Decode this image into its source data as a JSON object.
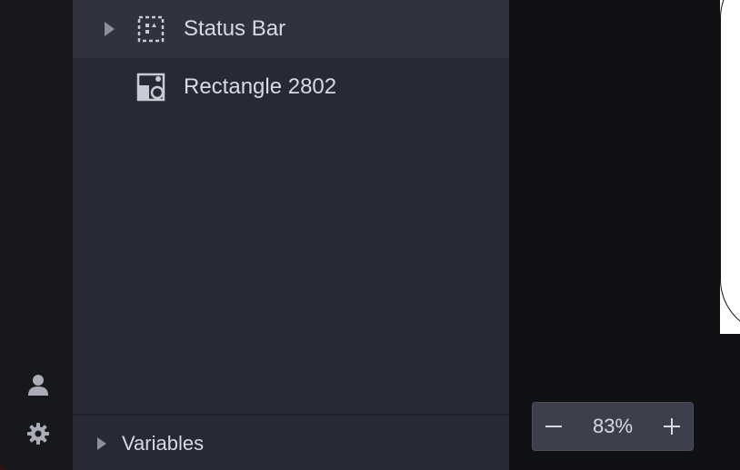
{
  "layers": [
    {
      "label": "Status Bar",
      "icon": "dashed-frame-icon",
      "expandable": true
    },
    {
      "label": "Rectangle 2802",
      "icon": "shapes-icon",
      "expandable": false
    }
  ],
  "variables_section": {
    "label": "Variables"
  },
  "zoom": {
    "value": "83%",
    "minus": "−",
    "plus": "+"
  },
  "rail": {
    "icons": [
      "user-icon",
      "gear-icon"
    ]
  },
  "colors": {
    "rail_bg": "#16181c",
    "panel_bg": "#272a35",
    "row_hover_bg": "#2f3340",
    "canvas_bg": "#101114",
    "text": "#d7dae2",
    "icon": "#a9adb7"
  }
}
